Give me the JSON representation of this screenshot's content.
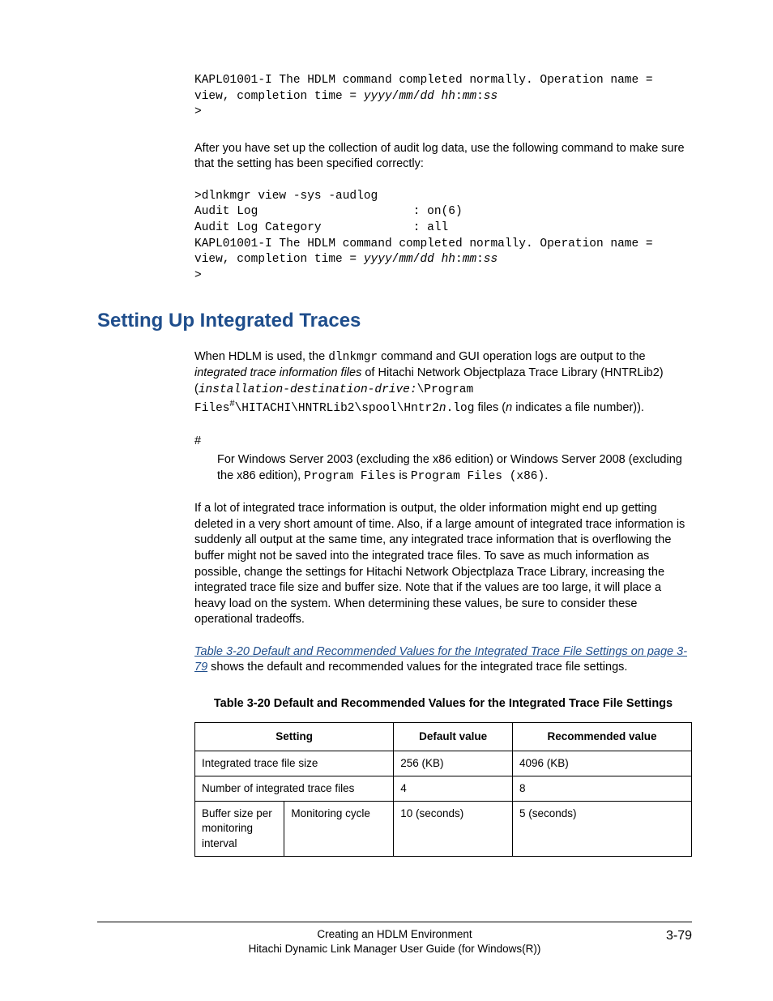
{
  "code1": {
    "line1_a": "KAPL01001-I The HDLM command completed normally. Operation name = ",
    "line2_a": "view, completion time = ",
    "line2_ts": "yyyy",
    "sep12": "/",
    "ts_mm": "mm",
    "sep23": "/",
    "ts_dd": "dd hh",
    "sep34": ":",
    "ts_mi": "mm",
    "sep45": ":",
    "ts_ss": "ss",
    "line3": ">"
  },
  "para1": "After you have set up the collection of audit log data, use the following command to make sure that the setting has been specified correctly:",
  "code2": {
    "l1": ">dlnkmgr view -sys -audlog",
    "l2": "Audit Log                      : on(6)",
    "l3": "Audit Log Category             : all",
    "l4": "KAPL01001-I The HDLM command completed normally. Operation name = ",
    "l5a": "view, completion time = ",
    "l6": ">"
  },
  "heading": "Setting Up Integrated Traces",
  "p2": {
    "a": "When HDLM is used, the ",
    "b": "dlnkmgr",
    "c": " command and GUI operation logs are output to the ",
    "d": "integrated trace information files",
    "e": " of Hitachi Network Objectplaza Trace Library (HNTRLib2) (",
    "f": "installation-destination-drive:",
    "g": "\\Program Files",
    "h": "#",
    "i": "\\HITACHI\\HNTRLib2\\spool\\Hntr2",
    "j": "n",
    "k": ".log",
    "l": " files (",
    "m": "n",
    "n": " indicates a file number))."
  },
  "hash": "#",
  "hashnote": {
    "a": "For Windows Server 2003 (excluding the x86 edition) or Windows Server 2008 (excluding the x86 edition), ",
    "b": "Program Files",
    "c": " is ",
    "d": "Program Files (x86)",
    "e": "."
  },
  "p3": "If a lot of integrated trace information is output, the older information might end up getting deleted in a very short amount of time. Also, if a large amount of integrated trace information is suddenly all output at the same time, any integrated trace information that is overflowing the buffer might not be saved into the integrated trace files. To save as much information as possible, change the settings for Hitachi Network Objectplaza Trace Library, increasing the integrated trace file size and buffer size. Note that if the values are too large, it will place a heavy load on the system. When determining these values, be sure to consider these operational tradeoffs.",
  "p4link": "Table 3-20 Default and Recommended Values for the Integrated Trace File Settings on page 3-79",
  "p4rest": " shows the default and recommended values for the integrated trace file settings.",
  "table_caption": "Table 3-20 Default and Recommended Values for the Integrated Trace File Settings",
  "th1": "Setting",
  "th2": "Default value",
  "th3": "Recommended value",
  "r1c1": "Integrated trace file size",
  "r1c2": "256 (KB)",
  "r1c3": "4096 (KB)",
  "r2c1": "Number of integrated trace files",
  "r2c2": "4",
  "r2c3": "8",
  "r3c1a": "Buffer size per monitoring interval",
  "r3c1b": "Monitoring cycle",
  "r3c2": "10 (seconds)",
  "r3c3": "5 (seconds)",
  "footer1": "Creating an HDLM Environment",
  "footer2": "Hitachi Dynamic Link Manager User Guide (for Windows(R))",
  "pagenum": "3-79"
}
